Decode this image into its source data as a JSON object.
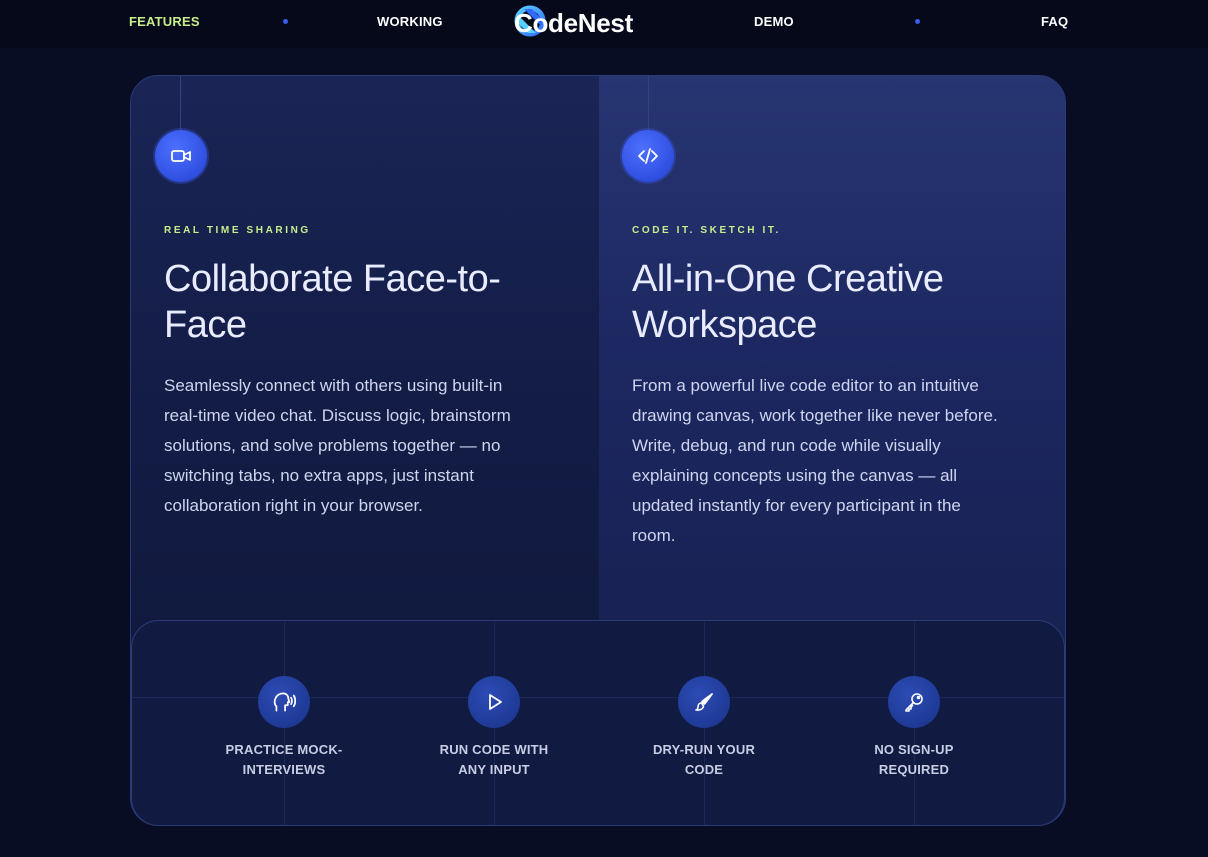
{
  "nav": {
    "links": [
      {
        "label": "FEATURES",
        "active": true
      },
      {
        "label": "WORKING",
        "active": false
      },
      {
        "label": "DEMO",
        "active": false
      },
      {
        "label": "FAQ",
        "active": false
      }
    ],
    "brand": "CodeNest",
    "logo_icon": "codenest-logo-icon"
  },
  "features": [
    {
      "icon": "video-camera-icon",
      "eyebrow": "REAL TIME SHARING",
      "title_line1": "Collaborate Face-to-",
      "title_line2": "Face",
      "body_lines": [
        "Seamlessly connect with others using built-in",
        "real-time video chat. Discuss logic, brainstorm",
        "solutions, and solve problems together — no",
        "switching tabs, no extra apps, just instant",
        "collaboration right in your browser."
      ]
    },
    {
      "icon": "code-brackets-icon",
      "eyebrow": "CODE IT. SKETCH IT.",
      "title_line1": "All-in-One Creative",
      "title_line2": "Workspace",
      "body_lines": [
        "From a powerful live code editor to an intuitive",
        "drawing canvas, work together like never before.",
        "Write, debug, and run code while visually",
        "explaining concepts using the canvas — all",
        "updated instantly for every participant in the",
        "room."
      ]
    }
  ],
  "highlights": [
    {
      "icon": "speaking-head-icon",
      "line1": "PRACTICE MOCK-",
      "line2": "INTERVIEWS"
    },
    {
      "icon": "play-icon",
      "line1": "RUN CODE WITH",
      "line2": "ANY INPUT"
    },
    {
      "icon": "paintbrush-icon",
      "line1": "DRY-RUN YOUR",
      "line2": "CODE"
    },
    {
      "icon": "key-icon",
      "line1": "NO SIGN-UP",
      "line2": "REQUIRED"
    }
  ],
  "colors": {
    "background": "#080d23",
    "accent_green": "#c7ee8a",
    "accent_blue": "#3b5bf0",
    "card_border": "#2a3a78"
  }
}
